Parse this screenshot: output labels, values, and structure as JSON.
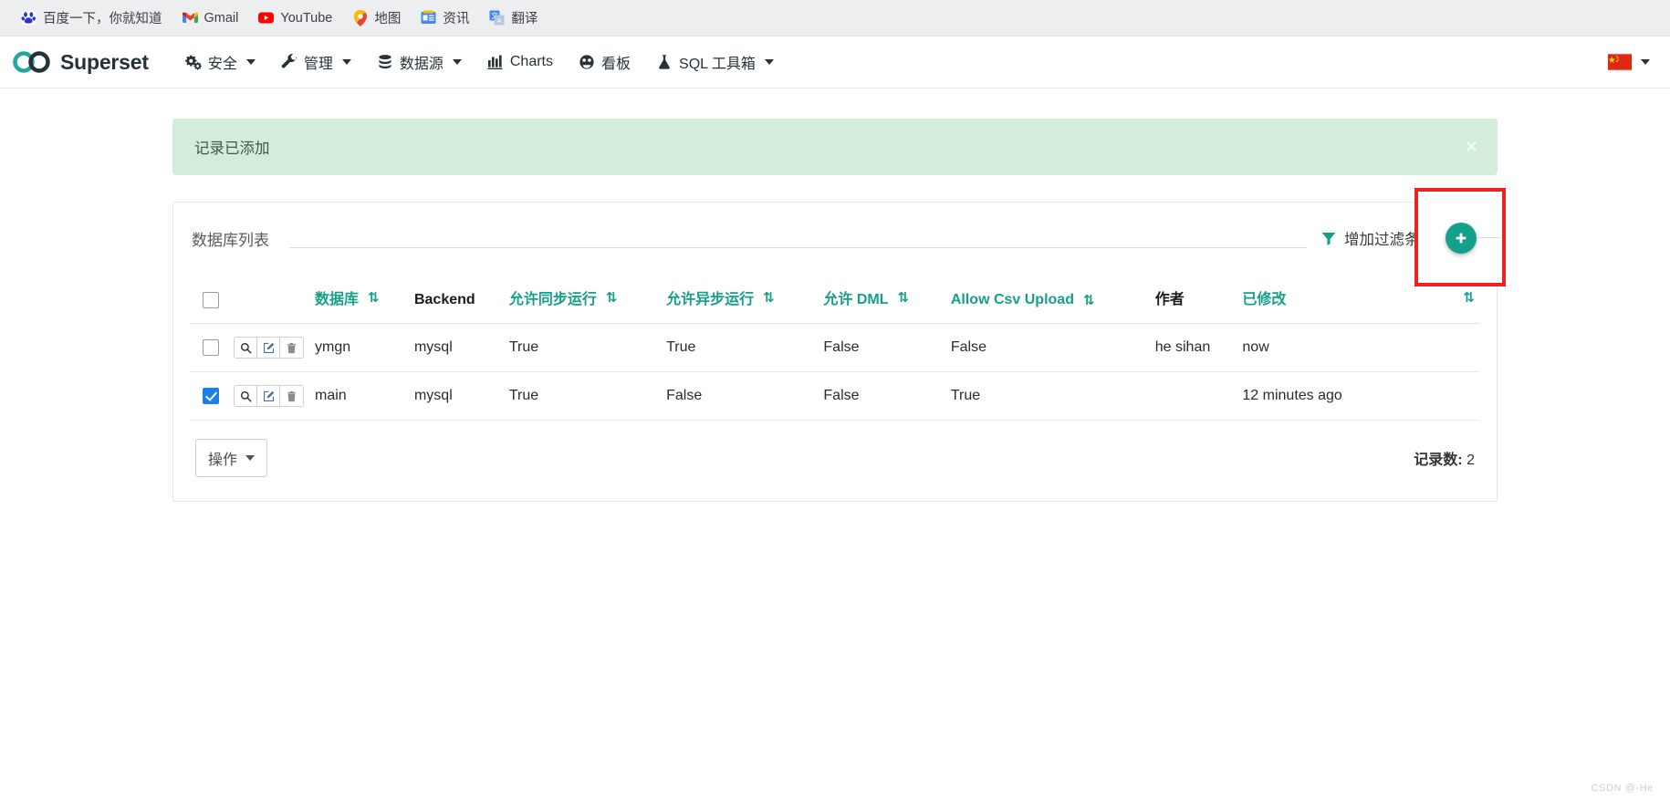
{
  "browser": {
    "bookmarks": [
      {
        "label": "百度一下，你就知道",
        "icon": "baidu-icon"
      },
      {
        "label": "Gmail",
        "icon": "gmail-icon"
      },
      {
        "label": "YouTube",
        "icon": "youtube-icon"
      },
      {
        "label": "地图",
        "icon": "google-maps-icon"
      },
      {
        "label": "资讯",
        "icon": "google-news-icon"
      },
      {
        "label": "翻译",
        "icon": "google-translate-icon"
      }
    ]
  },
  "navbar": {
    "brand": "Superset",
    "brand_icon": "superset-logo-icon",
    "items": [
      {
        "label": "安全",
        "icon": "gears-icon",
        "has_caret": true
      },
      {
        "label": "管理",
        "icon": "wrench-icon",
        "has_caret": true
      },
      {
        "label": "数据源",
        "icon": "database-icon",
        "has_caret": true
      },
      {
        "label": "Charts",
        "icon": "bar-chart-icon",
        "has_caret": false
      },
      {
        "label": "看板",
        "icon": "dashboard-icon",
        "has_caret": false
      },
      {
        "label": "SQL 工具箱",
        "icon": "flask-icon",
        "has_caret": true
      }
    ],
    "language": {
      "icon": "china-flag-icon",
      "has_caret": true
    }
  },
  "alert": {
    "message": "记录已添加",
    "close_label": "×",
    "bg_color": "#d4edda"
  },
  "panel": {
    "title": "数据库列表",
    "filter_label": "增加过滤条件",
    "filter_icon": "funnel-icon",
    "add_button_icon": "plus-icon",
    "accent_color": "#15a08a"
  },
  "table": {
    "columns": [
      {
        "label": "",
        "type": "checkbox",
        "sortable": false,
        "accent": false
      },
      {
        "label": "",
        "type": "actions",
        "sortable": false,
        "accent": false
      },
      {
        "label": "数据库",
        "type": "text",
        "sortable": true,
        "accent": true
      },
      {
        "label": "Backend",
        "type": "text",
        "sortable": false,
        "accent": false
      },
      {
        "label": "允许同步运行",
        "type": "text",
        "sortable": true,
        "accent": true
      },
      {
        "label": "允许异步运行",
        "type": "text",
        "sortable": true,
        "accent": true
      },
      {
        "label": "允许 DML",
        "type": "text",
        "sortable": true,
        "accent": true
      },
      {
        "label": "Allow Csv Upload",
        "type": "text",
        "sortable": true,
        "accent": true
      },
      {
        "label": "作者",
        "type": "text",
        "sortable": true,
        "accent": false
      },
      {
        "label": "已修改",
        "type": "text",
        "sortable": true,
        "accent": true
      }
    ],
    "header_checkbox_checked": false,
    "sort_icon": "⇅",
    "row_actions": [
      {
        "name": "show-record",
        "icon": "magnifier-icon",
        "glyph": "search"
      },
      {
        "name": "edit-record",
        "icon": "pencil-square-icon",
        "glyph": "edit"
      },
      {
        "name": "delete-record",
        "icon": "trash-icon",
        "glyph": "trash"
      }
    ],
    "rows": [
      {
        "selected": false,
        "database": "ymgn",
        "backend": "mysql",
        "allow_run_sync": "True",
        "allow_run_async": "True",
        "allow_dml": "False",
        "allow_csv_upload": "False",
        "author": "he sihan",
        "author_is_link": true,
        "modified": "now"
      },
      {
        "selected": true,
        "database": "main",
        "backend": "mysql",
        "allow_run_sync": "True",
        "allow_run_async": "False",
        "allow_dml": "False",
        "allow_csv_upload": "True",
        "author": "",
        "author_is_link": false,
        "modified": "12 minutes ago"
      }
    ]
  },
  "footer": {
    "actions_label": "操作",
    "count_label": "记录数:",
    "count_value": "2"
  },
  "watermark": "CSDN @-He"
}
